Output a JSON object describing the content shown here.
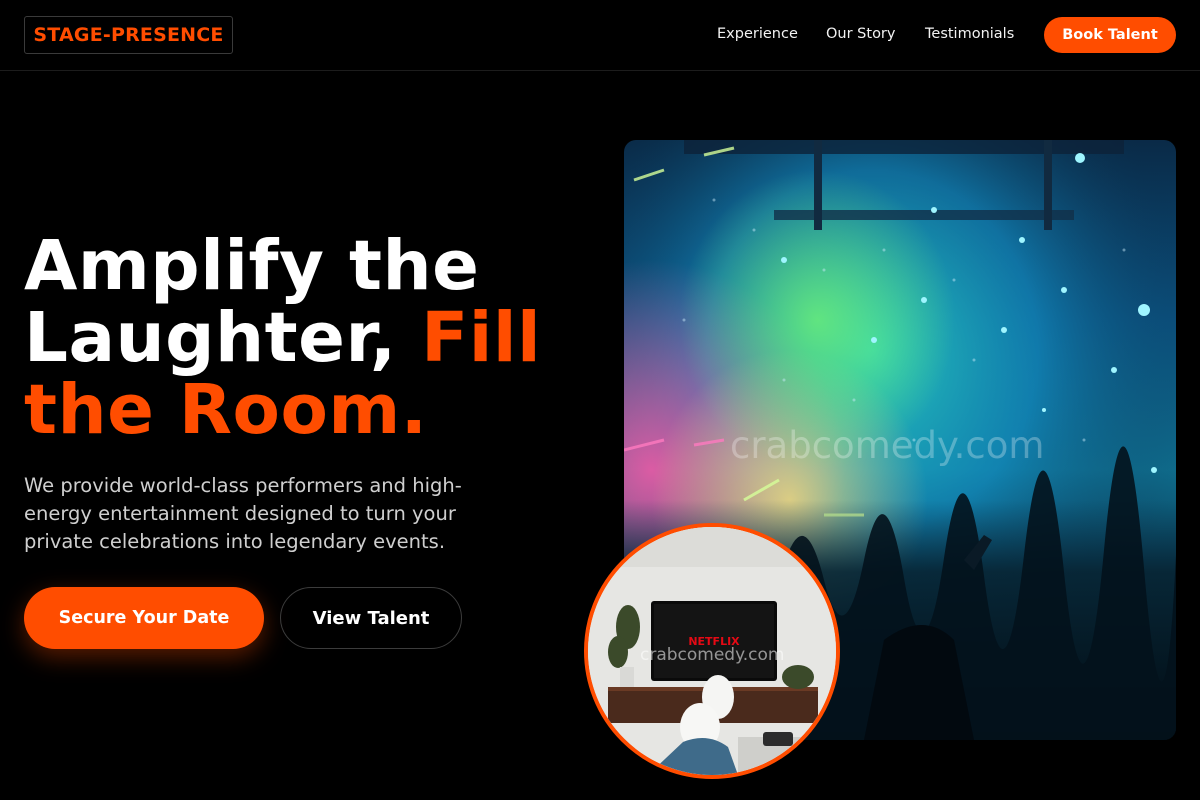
{
  "header": {
    "logo": "STAGE-PRESENCE",
    "nav": [
      {
        "label": "Experience"
      },
      {
        "label": "Our Story"
      },
      {
        "label": "Testimonials"
      }
    ],
    "cta": "Book Talent"
  },
  "hero": {
    "headline_line1": "Amplify the",
    "headline_line2_white": "Laughter, ",
    "headline_line2_accent": "Fill",
    "headline_line3_accent": "the Room.",
    "subtext": "We provide world-class performers and high-energy entertainment designed to turn your private celebrations into legendary events.",
    "primary_button": "Secure Your Date",
    "secondary_button": "View Talent"
  },
  "images": {
    "concert_watermark": "crabcomedy.com",
    "inset_watermark": "crabcomedy.com",
    "tv_brand": "NETFLIX"
  },
  "colors": {
    "accent": "#ff4d00",
    "background": "#000000"
  }
}
